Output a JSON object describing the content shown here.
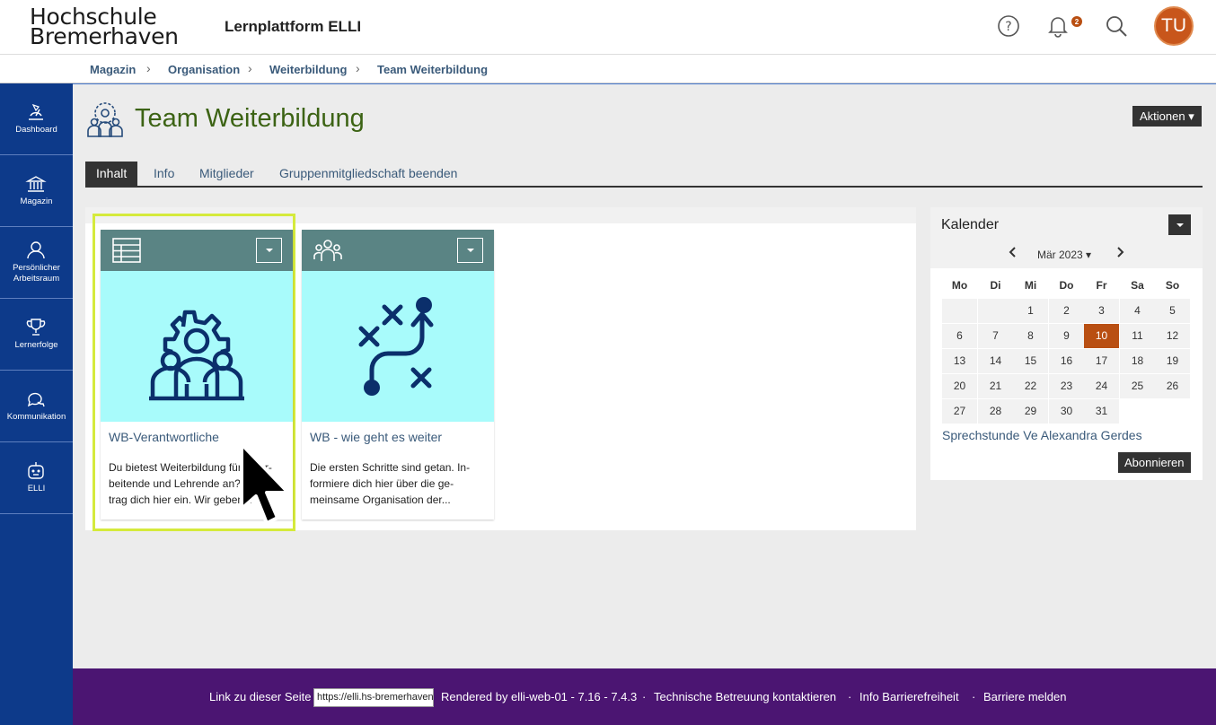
{
  "header": {
    "logo_line1": "Hochschule",
    "logo_line2": "Bremerhaven",
    "platform_title": "Lernplattform ELLI",
    "notification_count": "2",
    "avatar_initials": "TU"
  },
  "breadcrumb": [
    "Magazin",
    "Organisation",
    "Weiterbildung",
    "Team Weiterbildung"
  ],
  "sidebar": {
    "items": [
      {
        "label": "Dashboard",
        "icon": "dashboard-icon"
      },
      {
        "label": "Magazin",
        "icon": "library-icon"
      },
      {
        "label_line1": "Persönlicher",
        "label_line2": "Arbeitsraum",
        "icon": "user-icon"
      },
      {
        "label": "Lernerfolge",
        "icon": "trophy-icon"
      },
      {
        "label": "Kommunikation",
        "icon": "chat-icon"
      },
      {
        "label": "ELLI",
        "icon": "robot-icon"
      }
    ]
  },
  "page": {
    "title": "Team Weiterbildung",
    "actions_label": "Aktionen",
    "tabs": [
      "Inhalt",
      "Info",
      "Mitglieder",
      "Gruppenmitgliedschaft beenden"
    ],
    "active_tab": "Inhalt"
  },
  "tiles": [
    {
      "title": "WB-Verantwortliche",
      "desc_line1": "Du bietest Weiterbildung für Mitar-",
      "desc_line2": "beitende und Lehrende an? Dann",
      "desc_line3": "trag dich hier ein. Wir geben...",
      "type_icon": "table-icon"
    },
    {
      "title": "WB - wie geht es weiter",
      "desc_line1": "Die ersten Schritte sind getan. In-",
      "desc_line2": "formiere dich hier über die ge-",
      "desc_line3": "meinsame Organisation der...",
      "type_icon": "group-icon"
    }
  ],
  "calendar": {
    "title": "Kalender",
    "month": "Mär 2023",
    "weekdays": [
      "Mo",
      "Di",
      "Mi",
      "Do",
      "Fr",
      "Sa",
      "So"
    ],
    "weeks": [
      [
        "",
        "",
        "1",
        "2",
        "3",
        "4",
        "5"
      ],
      [
        "6",
        "7",
        "8",
        "9",
        "10",
        "11",
        "12"
      ],
      [
        "13",
        "14",
        "15",
        "16",
        "17",
        "18",
        "19"
      ],
      [
        "20",
        "21",
        "22",
        "23",
        "24",
        "25",
        "26"
      ],
      [
        "27",
        "28",
        "29",
        "30",
        "31",
        "",
        ""
      ]
    ],
    "today": "10",
    "event": "Sprechstunde Ve Alexandra Gerdes",
    "subscribe_label": "Abonnieren"
  },
  "footer": {
    "link_label": "Link zu dieser Seite",
    "link_value": "https://elli.hs-bremerhaven.de",
    "rendered": "Rendered by elli-web-01 - 7.16 - 7.4.3",
    "support": "Technische Betreuung kontaktieren",
    "accessibility": "Info Barrierefreiheit",
    "report": "Barriere melden",
    "sep": "·"
  },
  "colors": {
    "sidebar": "#0d3a8a",
    "footer": "#4b1572",
    "title_green": "#3c6314",
    "tile_header": "#5a8484",
    "tile_image_bg": "#a8fbfb",
    "today": "#b94f12",
    "selection": "#d5ea3c"
  }
}
